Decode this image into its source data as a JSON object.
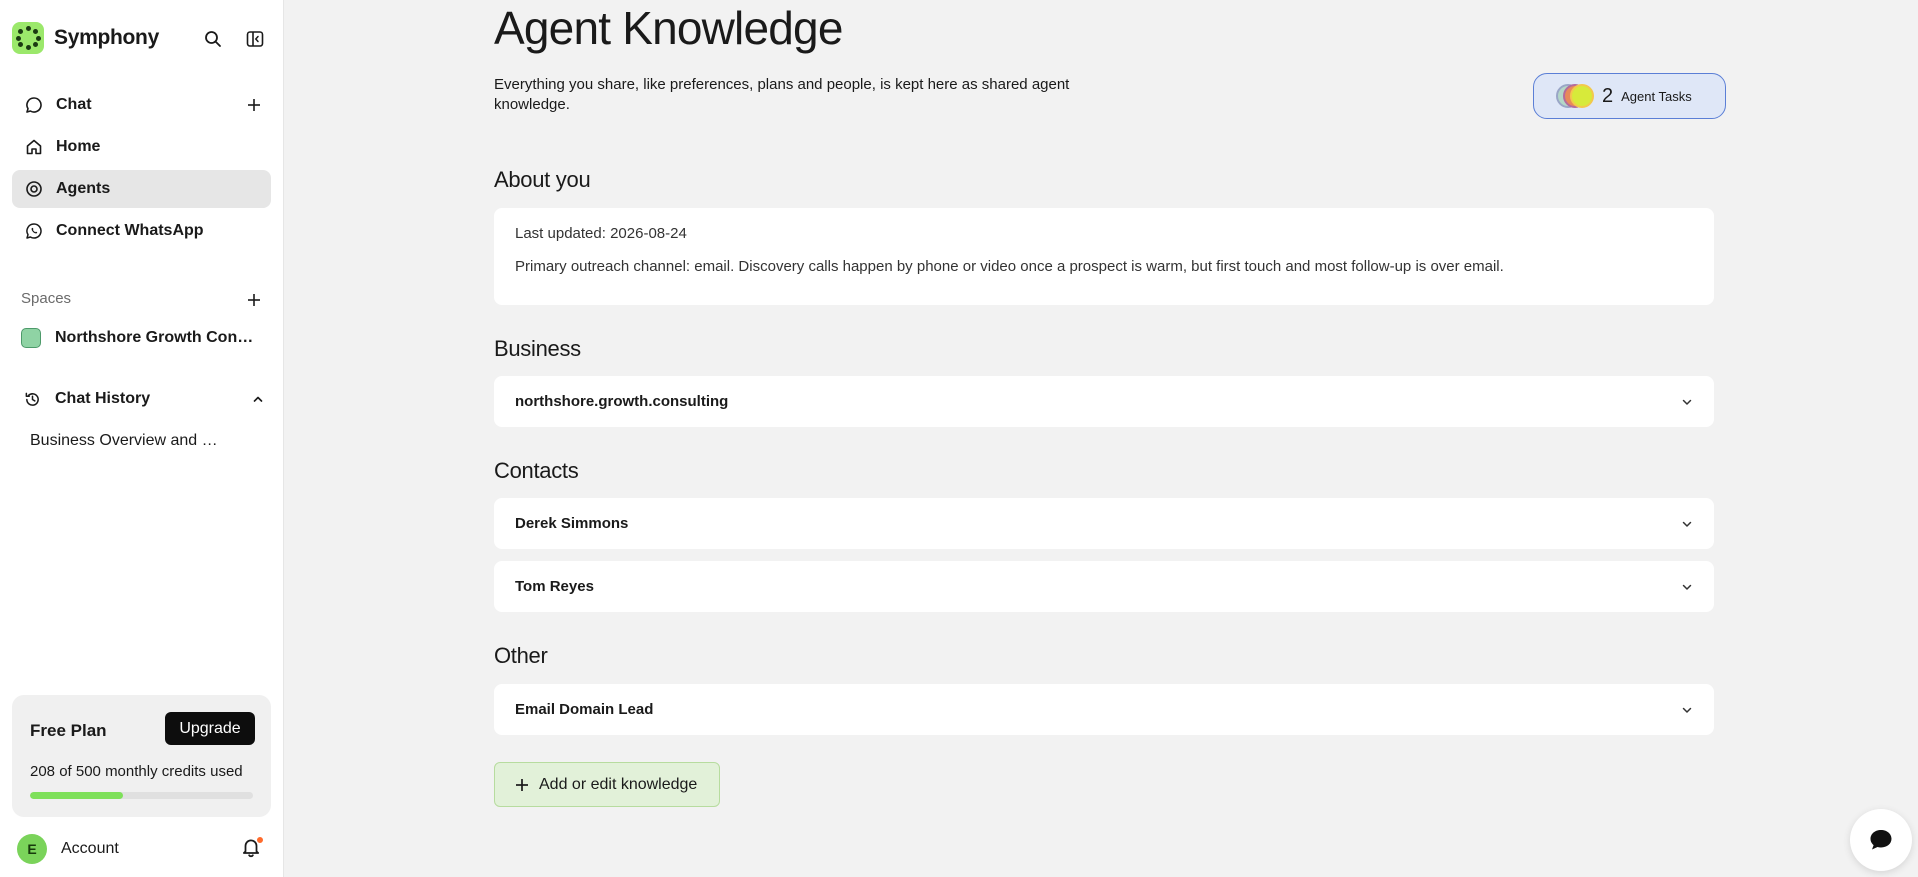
{
  "app": {
    "brand": "Symphony"
  },
  "sidebar": {
    "nav": [
      {
        "label": "Chat",
        "icon": "chat-bubble-icon"
      },
      {
        "label": "Home",
        "icon": "home-icon"
      },
      {
        "label": "Agents",
        "icon": "agents-icon",
        "active": true
      },
      {
        "label": "Connect WhatsApp",
        "icon": "whatsapp-icon"
      }
    ],
    "spaces_label": "Spaces",
    "spaces": [
      {
        "name": "Northshore Growth Consulting"
      }
    ],
    "history_label": "Chat History",
    "history": [
      {
        "title": "Business Overview and Goals"
      }
    ],
    "plan": {
      "name": "Free Plan",
      "upgrade_label": "Upgrade",
      "credits_text": "208 of 500 monthly credits used",
      "credits_used": 208,
      "credits_total": 500
    },
    "account": {
      "initial": "E",
      "label": "Account"
    }
  },
  "main": {
    "title": "Agent Knowledge",
    "subtitle": "Everything you share, like preferences, plans and people, is kept here as shared agent knowledge.",
    "tasks": {
      "count": "2",
      "label": "Agent Tasks"
    },
    "sections": {
      "about": {
        "title": "About you",
        "last_updated": "Last updated: 2026-08-24",
        "text": "Primary outreach channel: email. Discovery calls happen by phone or video once a prospect is warm, but first touch and most follow-up is over email."
      },
      "business": {
        "title": "Business",
        "items": [
          "northshore.growth.consulting"
        ]
      },
      "contacts": {
        "title": "Contacts",
        "items": [
          "Derek Simmons",
          "Tom Reyes"
        ]
      },
      "other": {
        "title": "Other",
        "items": [
          "Email Domain Lead"
        ]
      }
    },
    "add_button": "Add or edit knowledge"
  },
  "colors": {
    "accent_green": "#7ee05a",
    "tasks_border": "#5b7fd6",
    "tasks_bg": "#dfe7f7",
    "notification_dot": "#ff6b2c"
  }
}
